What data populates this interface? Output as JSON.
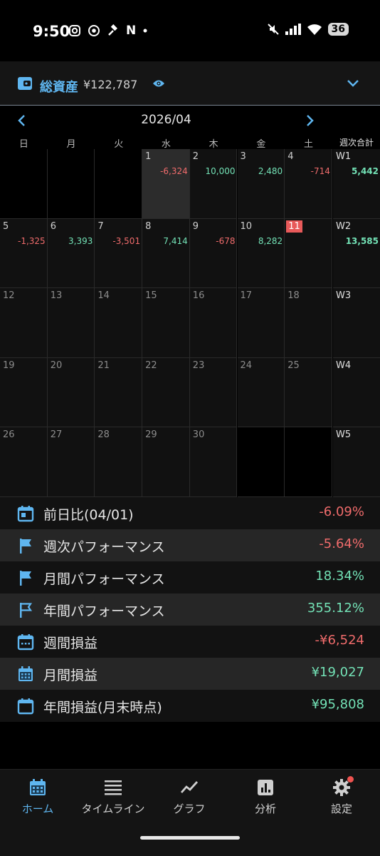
{
  "status_bar": {
    "time": "9:50",
    "n_icon": "N",
    "battery": "36"
  },
  "asset": {
    "label": "総資産",
    "value": "¥122,787"
  },
  "calendar": {
    "month": "2026/04",
    "weekdays": [
      "日",
      "月",
      "火",
      "水",
      "木",
      "金",
      "土"
    ],
    "weekly_total_label": "週次合計",
    "weeks": [
      {
        "label": "W1",
        "total": "5,442",
        "total_sign": "pos",
        "days": [
          null,
          null,
          null,
          {
            "d": "1",
            "v": "-6,324",
            "s": "neg",
            "sel": true
          },
          {
            "d": "2",
            "v": "10,000",
            "s": "pos"
          },
          {
            "d": "3",
            "v": "2,480",
            "s": "pos"
          },
          {
            "d": "4",
            "v": "-714",
            "s": "neg"
          }
        ]
      },
      {
        "label": "W2",
        "total": "13,585",
        "total_sign": "pos",
        "days": [
          {
            "d": "5",
            "v": "-1,325",
            "s": "neg"
          },
          {
            "d": "6",
            "v": "3,393",
            "s": "pos"
          },
          {
            "d": "7",
            "v": "-3,501",
            "s": "neg"
          },
          {
            "d": "8",
            "v": "7,414",
            "s": "pos"
          },
          {
            "d": "9",
            "v": "-678",
            "s": "neg"
          },
          {
            "d": "10",
            "v": "8,282",
            "s": "pos"
          },
          {
            "d": "11",
            "v": "",
            "s": "",
            "today": true
          }
        ]
      },
      {
        "label": "W3",
        "total": "",
        "total_sign": "",
        "days": [
          {
            "d": "12",
            "f": true
          },
          {
            "d": "13",
            "f": true
          },
          {
            "d": "14",
            "f": true
          },
          {
            "d": "15",
            "f": true
          },
          {
            "d": "16",
            "f": true
          },
          {
            "d": "17",
            "f": true
          },
          {
            "d": "18",
            "f": true
          }
        ]
      },
      {
        "label": "W4",
        "total": "",
        "total_sign": "",
        "days": [
          {
            "d": "19",
            "f": true
          },
          {
            "d": "20",
            "f": true
          },
          {
            "d": "21",
            "f": true
          },
          {
            "d": "22",
            "f": true
          },
          {
            "d": "23",
            "f": true
          },
          {
            "d": "24",
            "f": true
          },
          {
            "d": "25",
            "f": true
          }
        ]
      },
      {
        "label": "W5",
        "total": "",
        "total_sign": "",
        "days": [
          {
            "d": "26",
            "f": true
          },
          {
            "d": "27",
            "f": true
          },
          {
            "d": "28",
            "f": true
          },
          {
            "d": "29",
            "f": true
          },
          {
            "d": "30",
            "f": true
          },
          null,
          null
        ]
      }
    ]
  },
  "stats": [
    {
      "icon": "calendar-day-icon",
      "label": "前日比(04/01)",
      "value": "-6.09%",
      "sign": "neg"
    },
    {
      "icon": "flag-icon",
      "label": "週次パフォーマンス",
      "value": "-5.64%",
      "sign": "neg"
    },
    {
      "icon": "flag-icon",
      "label": "月間パフォーマンス",
      "value": "18.34%",
      "sign": "pos"
    },
    {
      "icon": "flag-outline-icon",
      "label": "年間パフォーマンス",
      "value": "355.12%",
      "sign": "pos"
    },
    {
      "icon": "calendar-week-icon",
      "label": "週間損益",
      "value": "-¥6,524",
      "sign": "neg"
    },
    {
      "icon": "calendar-month-icon",
      "label": "月間損益",
      "value": "¥19,027",
      "sign": "pos"
    },
    {
      "icon": "calendar-blank-icon",
      "label": "年間損益(月末時点)",
      "value": "¥95,808",
      "sign": "pos"
    }
  ],
  "nav": [
    {
      "icon": "calendar-icon",
      "label": "ホーム",
      "active": true
    },
    {
      "icon": "list-icon",
      "label": "タイムライン"
    },
    {
      "icon": "chart-line-icon",
      "label": "グラフ"
    },
    {
      "icon": "bar-chart-icon",
      "label": "分析"
    },
    {
      "icon": "gear-icon",
      "label": "設定"
    }
  ],
  "colors": {
    "accent": "#5fb6f0",
    "positive": "#73e2b6",
    "negative": "#ef6b6b",
    "today": "#e85a5a"
  }
}
